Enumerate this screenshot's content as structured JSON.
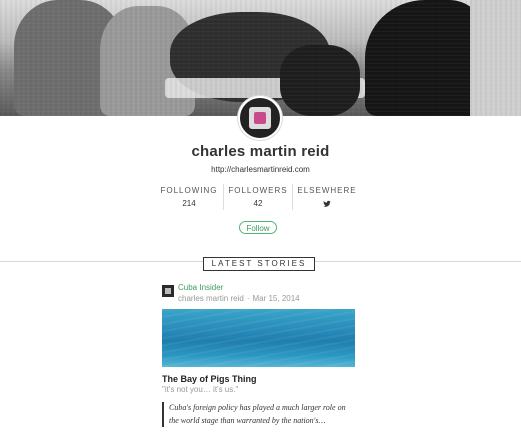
{
  "profile": {
    "name": "charles martin reid",
    "url": "http://charlesmartinreid.com"
  },
  "stats": {
    "following_label": "FOLLOWING",
    "following_value": "214",
    "followers_label": "FOLLOWERS",
    "followers_value": "42",
    "elsewhere_label": "ELSEWHERE",
    "elsewhere_icon": "twitter-icon"
  },
  "follow_button": {
    "label": "Follow",
    "color": "#3d9b63"
  },
  "section": {
    "latest_label": "LATEST STORIES"
  },
  "story": {
    "collection": "Cuba Insider",
    "author": "charles martin reid",
    "separator": "·",
    "date": "Mar 15, 2014",
    "title": "The Bay of Pigs Thing",
    "subtitle": "\"it's not you… it's us.\"",
    "excerpt_line1": "Cuba's foreign policy has played a much larger role on",
    "excerpt_line2": "the world stage than warranted by the nation's…"
  }
}
